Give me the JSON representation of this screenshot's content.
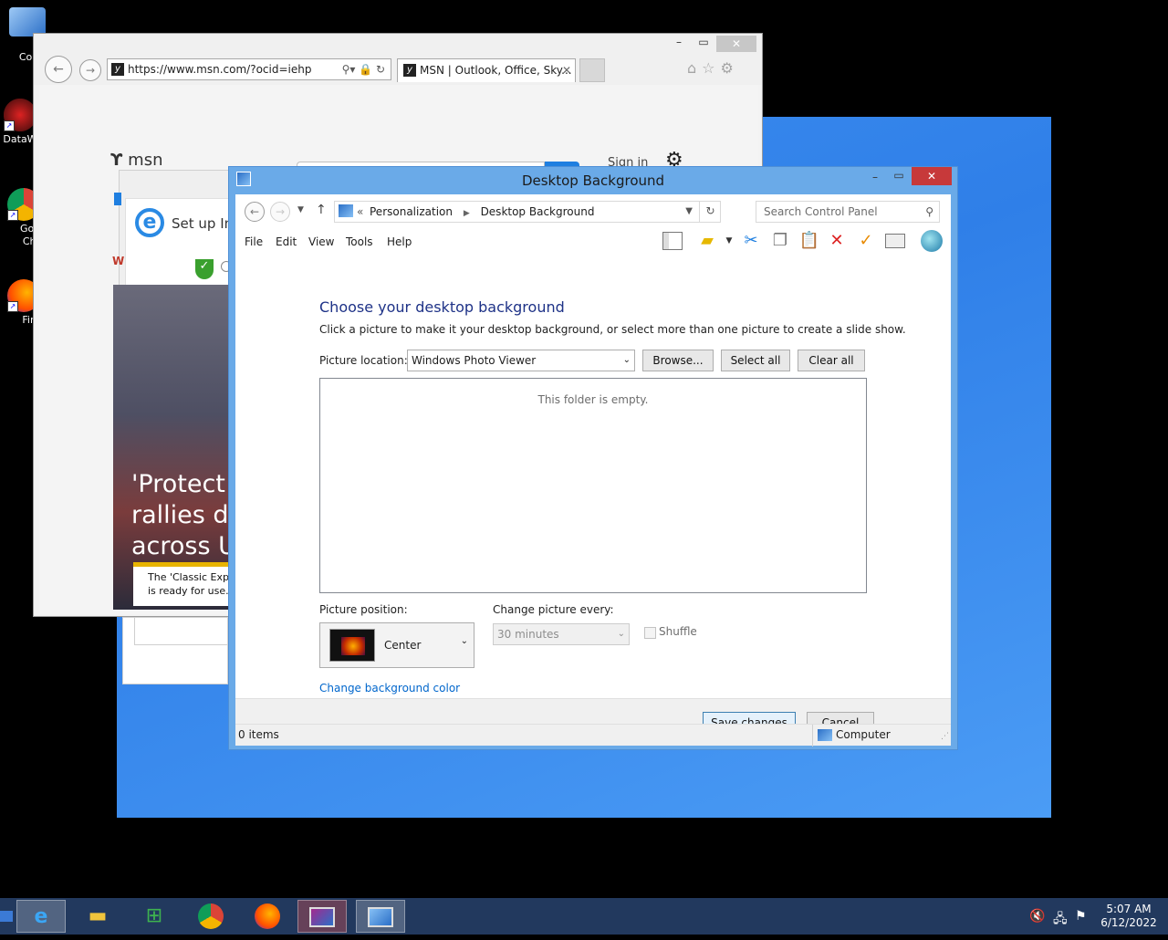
{
  "desktop": {
    "icons": [
      {
        "label": "M\nCom",
        "name": "my-computer"
      },
      {
        "label": "DataW",
        "name": "datawatch"
      },
      {
        "label": "Goo\nChr",
        "name": "google-chrome"
      },
      {
        "label": "Fire",
        "name": "firefox"
      }
    ]
  },
  "ie": {
    "url": "https://www.msn.com/?ocid=iehp",
    "tab_title": "MSN | Outlook, Office, Sky...",
    "msn_logo": "msn",
    "sign_in": "Sign in",
    "setup_title": "Set up Int",
    "news_headline": "'Protect\nrallies dr\nacross U",
    "news_notice": "The 'Classic Expl\nis ready for use.",
    "w_letter": "W"
  },
  "window": {
    "title": "Desktop Background",
    "breadcrumb": [
      "Personalization",
      "Desktop Background"
    ],
    "breadcrumb_prefix": "«",
    "search_placeholder": "Search Control Panel",
    "menu": [
      "File",
      "Edit",
      "View",
      "Tools",
      "Help"
    ],
    "heading": "Choose your desktop background",
    "instruction": "Click a picture to make it your desktop background, or select more than one picture to create a slide show.",
    "picture_location_label": "Picture location:",
    "picture_location_value": "Windows Photo Viewer",
    "browse": "Browse...",
    "select_all": "Select all",
    "clear_all": "Clear all",
    "empty_message": "This folder is empty.",
    "picture_position_label": "Picture position:",
    "picture_position_value": "Center",
    "change_every_label": "Change picture every:",
    "change_every_value": "30 minutes",
    "shuffle_label": "Shuffle",
    "change_color_link": "Change background color",
    "save": "Save changes",
    "cancel": "Cancel",
    "status_items": "0 items",
    "status_location": "Computer"
  },
  "taskbar": {
    "apps": [
      "internet-explorer",
      "file-explorer",
      "store",
      "chrome",
      "firefox",
      "display-settings",
      "control-panel"
    ],
    "time": "5:07 AM",
    "date": "6/12/2022"
  },
  "colors": {
    "accent": "#1f7fe0",
    "title_blue": "#6aaae8",
    "heading_blue": "#1e3287",
    "link_blue": "#0066cc",
    "taskbar": "#22395e",
    "close_red": "#c7393a"
  }
}
